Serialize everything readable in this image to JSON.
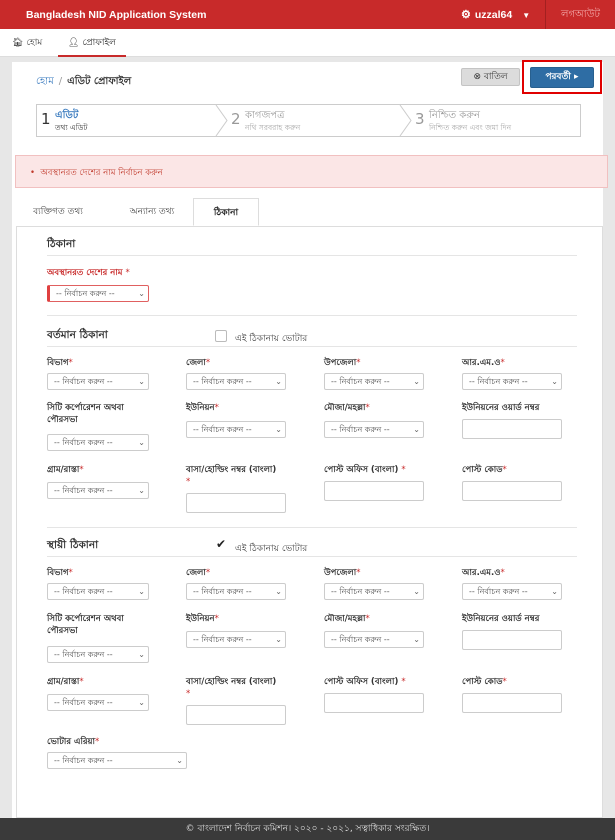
{
  "header": {
    "app_title": "Bangladesh NID Application System",
    "username": "uzzal64",
    "logout": "লগআউট"
  },
  "nav_tabs": [
    {
      "label": "হোম"
    },
    {
      "label": "প্রোফাইল"
    }
  ],
  "breadcrumb": {
    "home": "হোম",
    "current": "এডিট প্রোফাইল"
  },
  "actions": {
    "cancel": "বাতিল",
    "next": "পরবর্তী"
  },
  "steps": [
    {
      "num": "1",
      "title": "এডিট",
      "subtitle": "তথ্য এডিট"
    },
    {
      "num": "2",
      "title": "কাগজপত্র",
      "subtitle": "নথি সরবরাহ করুন"
    },
    {
      "num": "3",
      "title": "নিশ্চিত করুন",
      "subtitle": "নিশ্চিত করুন এবং জমা দিন"
    }
  ],
  "alert": "অবস্থানরত দেশের নাম নির্বাচন করুন",
  "form_tabs": [
    {
      "label": "ব্যক্তিগত তথ্য"
    },
    {
      "label": "অন্যান্য তথ্য"
    },
    {
      "label": "ঠিকানা"
    }
  ],
  "address": {
    "section_title": "ঠিকানা",
    "country_label": "অবস্থানরত দেশের নাম",
    "select_placeholder": "-- নির্বাচন করুন --",
    "present": {
      "title": "বর্তমান ঠিকানা",
      "voter_checkbox": "এই ঠিকানায় ভোটার",
      "voter_checked": false
    },
    "permanent": {
      "title": "স্থায়ী ঠিকানা",
      "voter_checkbox": "এই ঠিকানায় ভোটার",
      "voter_checked": true
    },
    "fields": {
      "division": "বিভাগ",
      "district": "জেলা",
      "upazila": "উপজেলা",
      "rmo": "আর.এম.ও",
      "city_corp": "সিটি কর্পোরেশন অথবা পৌরসভা",
      "union": "ইউনিয়ন",
      "mouza": "মৌজা/মহল্লা",
      "union_ward": "ইউনিয়নের ওয়ার্ড নম্বর",
      "village": "গ্রাম/রাস্তা",
      "house": "বাসা/হোল্ডিং নম্বর (বাংলা)",
      "post_office": "পোস্ট অফিস (বাংলা)",
      "post_code": "পোস্ট কোড"
    },
    "voter_area_label": "ভোটার এরিয়া"
  },
  "footer": "© বাংলাদেশ নির্বাচন কমিশন। ২০২০ - ২০২১, সত্বাধিকার সংরক্ষিত।"
}
